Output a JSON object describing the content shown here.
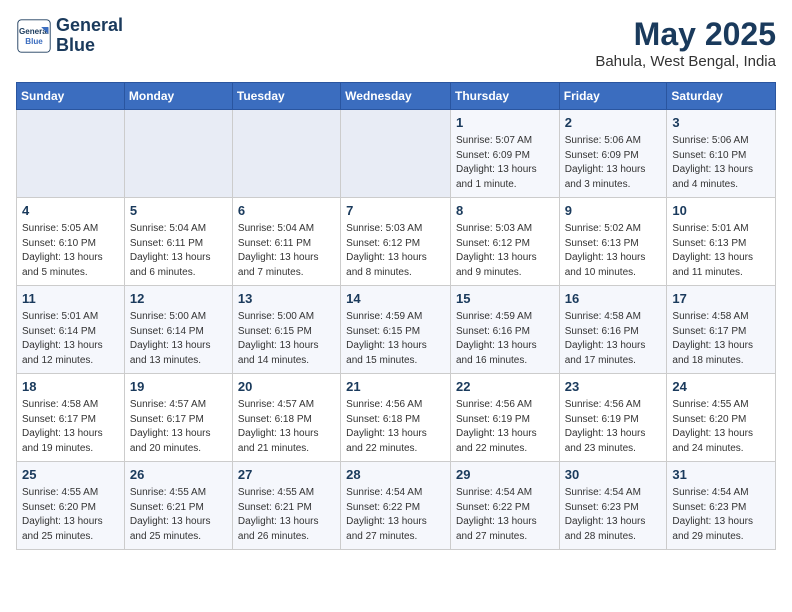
{
  "logo": {
    "line1": "General",
    "line2": "Blue"
  },
  "title": "May 2025",
  "subtitle": "Bahula, West Bengal, India",
  "days_of_week": [
    "Sunday",
    "Monday",
    "Tuesday",
    "Wednesday",
    "Thursday",
    "Friday",
    "Saturday"
  ],
  "weeks": [
    [
      {
        "num": "",
        "content": ""
      },
      {
        "num": "",
        "content": ""
      },
      {
        "num": "",
        "content": ""
      },
      {
        "num": "",
        "content": ""
      },
      {
        "num": "1",
        "content": "Sunrise: 5:07 AM\nSunset: 6:09 PM\nDaylight: 13 hours\nand 1 minute."
      },
      {
        "num": "2",
        "content": "Sunrise: 5:06 AM\nSunset: 6:09 PM\nDaylight: 13 hours\nand 3 minutes."
      },
      {
        "num": "3",
        "content": "Sunrise: 5:06 AM\nSunset: 6:10 PM\nDaylight: 13 hours\nand 4 minutes."
      }
    ],
    [
      {
        "num": "4",
        "content": "Sunrise: 5:05 AM\nSunset: 6:10 PM\nDaylight: 13 hours\nand 5 minutes."
      },
      {
        "num": "5",
        "content": "Sunrise: 5:04 AM\nSunset: 6:11 PM\nDaylight: 13 hours\nand 6 minutes."
      },
      {
        "num": "6",
        "content": "Sunrise: 5:04 AM\nSunset: 6:11 PM\nDaylight: 13 hours\nand 7 minutes."
      },
      {
        "num": "7",
        "content": "Sunrise: 5:03 AM\nSunset: 6:12 PM\nDaylight: 13 hours\nand 8 minutes."
      },
      {
        "num": "8",
        "content": "Sunrise: 5:03 AM\nSunset: 6:12 PM\nDaylight: 13 hours\nand 9 minutes."
      },
      {
        "num": "9",
        "content": "Sunrise: 5:02 AM\nSunset: 6:13 PM\nDaylight: 13 hours\nand 10 minutes."
      },
      {
        "num": "10",
        "content": "Sunrise: 5:01 AM\nSunset: 6:13 PM\nDaylight: 13 hours\nand 11 minutes."
      }
    ],
    [
      {
        "num": "11",
        "content": "Sunrise: 5:01 AM\nSunset: 6:14 PM\nDaylight: 13 hours\nand 12 minutes."
      },
      {
        "num": "12",
        "content": "Sunrise: 5:00 AM\nSunset: 6:14 PM\nDaylight: 13 hours\nand 13 minutes."
      },
      {
        "num": "13",
        "content": "Sunrise: 5:00 AM\nSunset: 6:15 PM\nDaylight: 13 hours\nand 14 minutes."
      },
      {
        "num": "14",
        "content": "Sunrise: 4:59 AM\nSunset: 6:15 PM\nDaylight: 13 hours\nand 15 minutes."
      },
      {
        "num": "15",
        "content": "Sunrise: 4:59 AM\nSunset: 6:16 PM\nDaylight: 13 hours\nand 16 minutes."
      },
      {
        "num": "16",
        "content": "Sunrise: 4:58 AM\nSunset: 6:16 PM\nDaylight: 13 hours\nand 17 minutes."
      },
      {
        "num": "17",
        "content": "Sunrise: 4:58 AM\nSunset: 6:17 PM\nDaylight: 13 hours\nand 18 minutes."
      }
    ],
    [
      {
        "num": "18",
        "content": "Sunrise: 4:58 AM\nSunset: 6:17 PM\nDaylight: 13 hours\nand 19 minutes."
      },
      {
        "num": "19",
        "content": "Sunrise: 4:57 AM\nSunset: 6:17 PM\nDaylight: 13 hours\nand 20 minutes."
      },
      {
        "num": "20",
        "content": "Sunrise: 4:57 AM\nSunset: 6:18 PM\nDaylight: 13 hours\nand 21 minutes."
      },
      {
        "num": "21",
        "content": "Sunrise: 4:56 AM\nSunset: 6:18 PM\nDaylight: 13 hours\nand 22 minutes."
      },
      {
        "num": "22",
        "content": "Sunrise: 4:56 AM\nSunset: 6:19 PM\nDaylight: 13 hours\nand 22 minutes."
      },
      {
        "num": "23",
        "content": "Sunrise: 4:56 AM\nSunset: 6:19 PM\nDaylight: 13 hours\nand 23 minutes."
      },
      {
        "num": "24",
        "content": "Sunrise: 4:55 AM\nSunset: 6:20 PM\nDaylight: 13 hours\nand 24 minutes."
      }
    ],
    [
      {
        "num": "25",
        "content": "Sunrise: 4:55 AM\nSunset: 6:20 PM\nDaylight: 13 hours\nand 25 minutes."
      },
      {
        "num": "26",
        "content": "Sunrise: 4:55 AM\nSunset: 6:21 PM\nDaylight: 13 hours\nand 25 minutes."
      },
      {
        "num": "27",
        "content": "Sunrise: 4:55 AM\nSunset: 6:21 PM\nDaylight: 13 hours\nand 26 minutes."
      },
      {
        "num": "28",
        "content": "Sunrise: 4:54 AM\nSunset: 6:22 PM\nDaylight: 13 hours\nand 27 minutes."
      },
      {
        "num": "29",
        "content": "Sunrise: 4:54 AM\nSunset: 6:22 PM\nDaylight: 13 hours\nand 27 minutes."
      },
      {
        "num": "30",
        "content": "Sunrise: 4:54 AM\nSunset: 6:23 PM\nDaylight: 13 hours\nand 28 minutes."
      },
      {
        "num": "31",
        "content": "Sunrise: 4:54 AM\nSunset: 6:23 PM\nDaylight: 13 hours\nand 29 minutes."
      }
    ]
  ]
}
